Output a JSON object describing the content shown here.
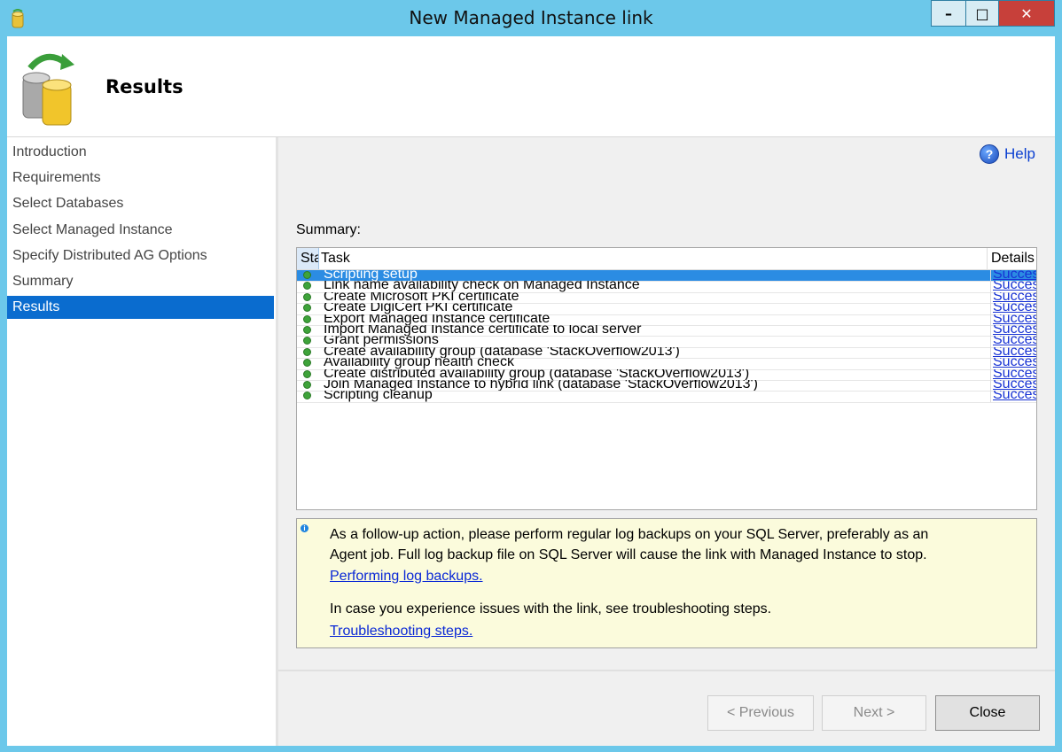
{
  "window": {
    "title": "New Managed Instance link",
    "controls": {
      "minimize": "–",
      "maximize": "□",
      "close": "✕"
    }
  },
  "header": {
    "title": "Results"
  },
  "nav": {
    "items": [
      {
        "label": "Introduction"
      },
      {
        "label": "Requirements"
      },
      {
        "label": "Select Databases"
      },
      {
        "label": "Select Managed Instance"
      },
      {
        "label": "Specify Distributed AG Options"
      },
      {
        "label": "Summary"
      },
      {
        "label": "Results",
        "active": true
      }
    ]
  },
  "help": {
    "label": "Help",
    "icon": "help-icon"
  },
  "summary": {
    "label": "Summary:",
    "columns": {
      "status": "Status",
      "task": "Task",
      "details": "Details"
    },
    "rows": [
      {
        "task": "Scripting setup",
        "details": "Success"
      },
      {
        "task": "Link name availability check on Managed Instance",
        "details": "Success"
      },
      {
        "task": "Create Microsoft PKI certificate",
        "details": "Success"
      },
      {
        "task": "Create DigiCert PKI certificate",
        "details": "Success"
      },
      {
        "task": "Export Managed Instance certificate",
        "details": "Success"
      },
      {
        "task": "Import Managed Instance certificate to local server",
        "details": "Success"
      },
      {
        "task": "Grant permissions",
        "details": "Success"
      },
      {
        "task": "Create availability group (database 'StackOverflow2013')",
        "details": "Success"
      },
      {
        "task": "Availability group health check",
        "details": "Success"
      },
      {
        "task": "Create distributed availability group (database 'StackOverflow2013')",
        "details": "Success"
      },
      {
        "task": "Join Managed Instance to hybrid link (database 'StackOverflow2013')",
        "details": "Success"
      },
      {
        "task": "Scripting cleanup",
        "details": "Success"
      }
    ]
  },
  "info": {
    "line1": "As a follow-up action, please perform regular log backups on your SQL Server, preferably as an",
    "line2": "Agent job. Full log backup file on SQL Server will cause the link with Managed Instance to stop.",
    "link1": "Performing log backups.",
    "line3": "In case you experience issues with the link, see troubleshooting steps.",
    "link2": "Troubleshooting steps."
  },
  "buttons": {
    "previous": "< Previous",
    "next": "Next >",
    "close": "Close"
  }
}
